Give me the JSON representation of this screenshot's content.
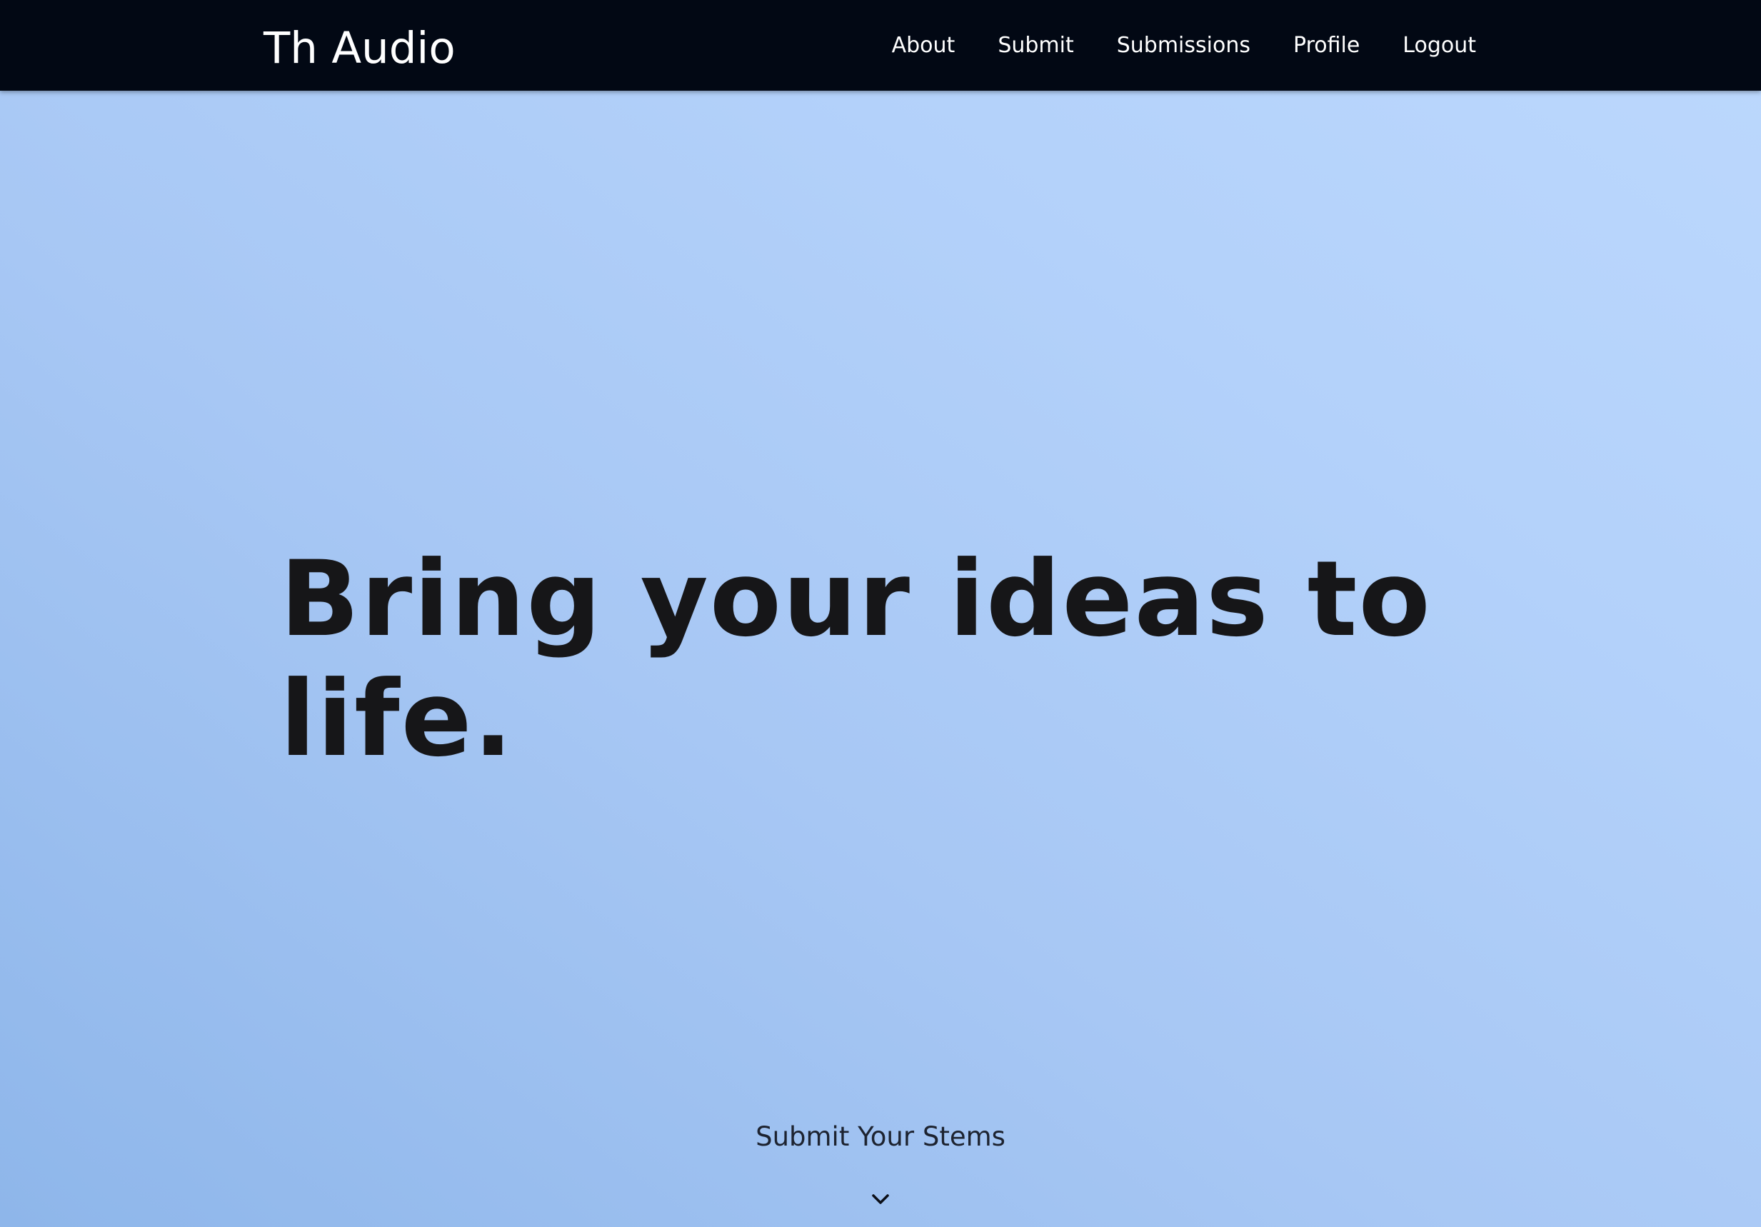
{
  "navbar": {
    "brand": "Th Audio",
    "links": [
      {
        "label": "About"
      },
      {
        "label": "Submit"
      },
      {
        "label": "Submissions"
      },
      {
        "label": "Profile"
      },
      {
        "label": "Logout"
      }
    ]
  },
  "hero": {
    "title": "Bring your ideas to life."
  },
  "cta": {
    "label": "Submit Your Stems",
    "icon": "chevron-down-icon"
  },
  "colors": {
    "navbar_bg": "#020814",
    "hero_text": "#161618",
    "background_light": "#bcd8fd",
    "background_dark": "#8eb6ea"
  }
}
